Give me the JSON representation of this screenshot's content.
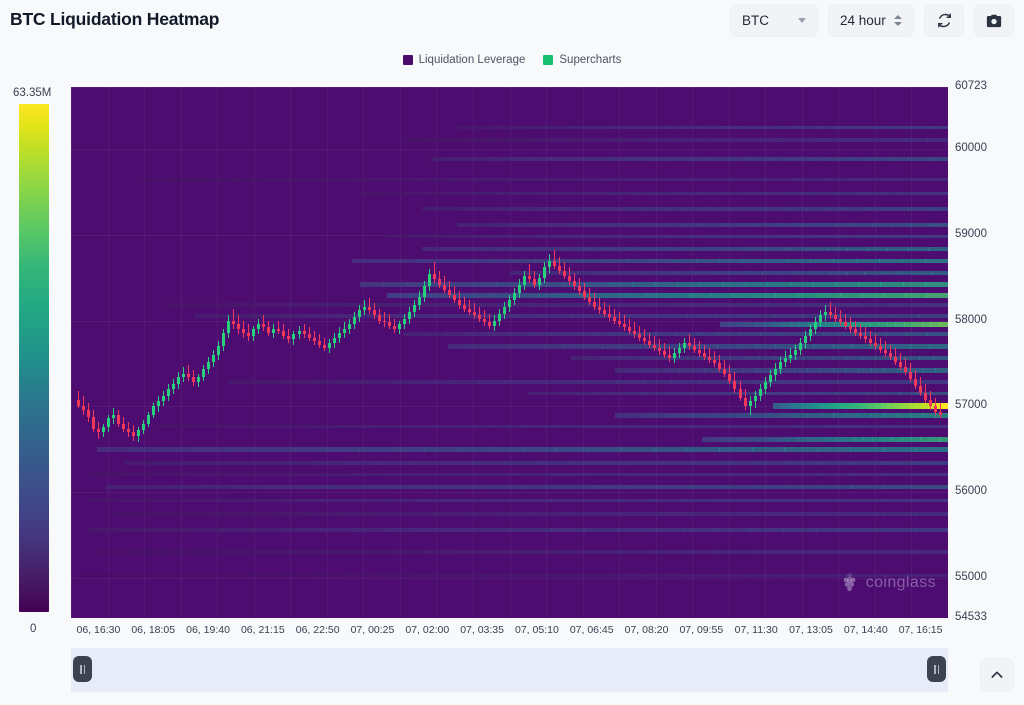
{
  "header": {
    "title": "BTC Liquidation Heatmap",
    "symbol_label": "BTC",
    "period_label": "24 hour",
    "refresh_icon": "refresh-icon",
    "camera_icon": "camera-icon"
  },
  "legend": [
    {
      "label": "Liquidation Leverage",
      "color": "#4b0a6e"
    },
    {
      "label": "Supercharts",
      "color": "#18bf6e"
    }
  ],
  "colorbar": {
    "max_label": "63.35M",
    "min_label": "0"
  },
  "watermark": {
    "text": "coinglass"
  },
  "chart_data": {
    "type": "heatmap",
    "title": "BTC Liquidation Heatmap",
    "xlabel": "",
    "ylabel": "",
    "grid": true,
    "legend_position": "top-center",
    "colorbar": {
      "label": "Liquidation Leverage",
      "min": 0,
      "max": 63350000,
      "max_label": "63.35M",
      "min_label": "0",
      "scale": "viridis"
    },
    "ylim": [
      54533,
      60723
    ],
    "y_ticks": [
      60723,
      60000,
      59000,
      58000,
      57000,
      56000,
      55000,
      54533
    ],
    "y_tick_labels": [
      "60723",
      "60000",
      "59000",
      "58000",
      "57000",
      "56000",
      "55000",
      "54533"
    ],
    "x_tick_labels": [
      "06, 16:30",
      "06, 18:05",
      "06, 19:40",
      "06, 21:15",
      "06, 22:50",
      "07, 00:25",
      "07, 02:00",
      "07, 03:35",
      "07, 05:10",
      "07, 06:45",
      "07, 08:20",
      "07, 09:55",
      "07, 11:30",
      "07, 13:05",
      "07, 14:40",
      "07, 16:15"
    ],
    "price_series_name": "BTC price (candlesticks)",
    "up_color": "#26d07c",
    "down_color": "#f2385a",
    "bands": [
      {
        "price": 60250,
        "start": 0.44,
        "intensity": 0.3
      },
      {
        "price": 60100,
        "start": 0.38,
        "intensity": 0.22
      },
      {
        "price": 59880,
        "start": 0.41,
        "intensity": 0.36
      },
      {
        "price": 59640,
        "start": 0.08,
        "intensity": 0.2
      },
      {
        "price": 59480,
        "start": 0.33,
        "intensity": 0.26
      },
      {
        "price": 59300,
        "start": 0.4,
        "intensity": 0.34
      },
      {
        "price": 59120,
        "start": 0.44,
        "intensity": 0.4
      },
      {
        "price": 58980,
        "start": 0.36,
        "intensity": 0.3
      },
      {
        "price": 58840,
        "start": 0.4,
        "intensity": 0.46
      },
      {
        "price": 58700,
        "start": 0.32,
        "intensity": 0.52
      },
      {
        "price": 58560,
        "start": 0.5,
        "intensity": 0.44
      },
      {
        "price": 58430,
        "start": 0.33,
        "intensity": 0.62
      },
      {
        "price": 58300,
        "start": 0.36,
        "intensity": 0.7
      },
      {
        "price": 58180,
        "start": 0.11,
        "intensity": 0.26
      },
      {
        "price": 58050,
        "start": 0.14,
        "intensity": 0.34
      },
      {
        "price": 57960,
        "start": 0.74,
        "intensity": 0.78
      },
      {
        "price": 57840,
        "start": 0.38,
        "intensity": 0.4
      },
      {
        "price": 57700,
        "start": 0.43,
        "intensity": 0.48
      },
      {
        "price": 57560,
        "start": 0.57,
        "intensity": 0.42
      },
      {
        "price": 57420,
        "start": 0.62,
        "intensity": 0.46
      },
      {
        "price": 57280,
        "start": 0.18,
        "intensity": 0.3
      },
      {
        "price": 57150,
        "start": 0.52,
        "intensity": 0.38
      },
      {
        "price": 57020,
        "start": 0.8,
        "intensity": 1.0
      },
      {
        "price": 56900,
        "start": 0.62,
        "intensity": 0.56
      },
      {
        "price": 56760,
        "start": 0.1,
        "intensity": 0.26
      },
      {
        "price": 56620,
        "start": 0.72,
        "intensity": 0.66
      },
      {
        "price": 56500,
        "start": 0.03,
        "intensity": 0.5
      },
      {
        "price": 56340,
        "start": 0.06,
        "intensity": 0.32
      },
      {
        "price": 56200,
        "start": 0.02,
        "intensity": 0.24
      },
      {
        "price": 56060,
        "start": 0.04,
        "intensity": 0.38
      },
      {
        "price": 55900,
        "start": 0.02,
        "intensity": 0.28
      },
      {
        "price": 55740,
        "start": 0.05,
        "intensity": 0.22
      },
      {
        "price": 55560,
        "start": 0.02,
        "intensity": 0.3
      },
      {
        "price": 55300,
        "start": 0.03,
        "intensity": 0.2
      },
      {
        "price": 55020,
        "start": 0.01,
        "intensity": 0.16
      }
    ],
    "candles": [
      [
        57080,
        57180,
        56980,
        57010
      ],
      [
        57010,
        57120,
        56900,
        56960
      ],
      [
        56960,
        57040,
        56820,
        56880
      ],
      [
        56880,
        56960,
        56700,
        56740
      ],
      [
        56740,
        56820,
        56620,
        56700
      ],
      [
        56700,
        56800,
        56640,
        56760
      ],
      [
        56760,
        56900,
        56700,
        56860
      ],
      [
        56860,
        56980,
        56800,
        56900
      ],
      [
        56900,
        56960,
        56760,
        56800
      ],
      [
        56800,
        56880,
        56700,
        56740
      ],
      [
        56740,
        56820,
        56640,
        56700
      ],
      [
        56700,
        56780,
        56600,
        56660
      ],
      [
        56660,
        56760,
        56580,
        56720
      ],
      [
        56720,
        56840,
        56680,
        56800
      ],
      [
        56800,
        56940,
        56760,
        56900
      ],
      [
        56900,
        57040,
        56860,
        57000
      ],
      [
        57000,
        57120,
        56940,
        57060
      ],
      [
        57060,
        57180,
        57000,
        57120
      ],
      [
        57120,
        57260,
        57060,
        57200
      ],
      [
        57200,
        57320,
        57140,
        57260
      ],
      [
        57260,
        57400,
        57200,
        57340
      ],
      [
        57340,
        57460,
        57280,
        57380
      ],
      [
        57380,
        57480,
        57300,
        57340
      ],
      [
        57340,
        57420,
        57240,
        57280
      ],
      [
        57280,
        57380,
        57220,
        57340
      ],
      [
        57340,
        57480,
        57300,
        57440
      ],
      [
        57440,
        57580,
        57380,
        57520
      ],
      [
        57520,
        57660,
        57460,
        57600
      ],
      [
        57600,
        57760,
        57540,
        57700
      ],
      [
        57700,
        57900,
        57640,
        57860
      ],
      [
        57860,
        58060,
        57800,
        58000
      ],
      [
        58000,
        58140,
        57900,
        57960
      ],
      [
        57960,
        58060,
        57840,
        57900
      ],
      [
        57900,
        58000,
        57800,
        57860
      ],
      [
        57860,
        57960,
        57760,
        57820
      ],
      [
        57820,
        57940,
        57760,
        57900
      ],
      [
        57900,
        58020,
        57840,
        57960
      ],
      [
        57960,
        58060,
        57880,
        57920
      ],
      [
        57920,
        58000,
        57820,
        57860
      ],
      [
        57860,
        57960,
        57800,
        57900
      ],
      [
        57900,
        58000,
        57840,
        57880
      ],
      [
        57880,
        57960,
        57780,
        57820
      ],
      [
        57820,
        57900,
        57740,
        57780
      ],
      [
        57780,
        57880,
        57720,
        57840
      ],
      [
        57840,
        57940,
        57780,
        57880
      ],
      [
        57880,
        57960,
        57800,
        57840
      ],
      [
        57840,
        57920,
        57760,
        57800
      ],
      [
        57800,
        57880,
        57720,
        57760
      ],
      [
        57760,
        57840,
        57680,
        57720
      ],
      [
        57720,
        57800,
        57640,
        57680
      ],
      [
        57680,
        57780,
        57620,
        57740
      ],
      [
        57740,
        57860,
        57680,
        57800
      ],
      [
        57800,
        57920,
        57740,
        57860
      ],
      [
        57860,
        57980,
        57800,
        57900
      ],
      [
        57900,
        58020,
        57840,
        57960
      ],
      [
        57960,
        58100,
        57900,
        58040
      ],
      [
        58040,
        58180,
        57980,
        58120
      ],
      [
        58120,
        58240,
        58060,
        58160
      ],
      [
        58160,
        58260,
        58080,
        58120
      ],
      [
        58120,
        58200,
        58020,
        58060
      ],
      [
        58060,
        58140,
        57960,
        58000
      ],
      [
        58000,
        58100,
        57920,
        57980
      ],
      [
        57980,
        58080,
        57900,
        57940
      ],
      [
        57940,
        58020,
        57860,
        57900
      ],
      [
        57900,
        58000,
        57840,
        57960
      ],
      [
        57960,
        58080,
        57900,
        58020
      ],
      [
        58020,
        58160,
        57960,
        58100
      ],
      [
        58100,
        58240,
        58040,
        58180
      ],
      [
        58180,
        58340,
        58120,
        58280
      ],
      [
        58280,
        58460,
        58220,
        58400
      ],
      [
        58400,
        58600,
        58340,
        58540
      ],
      [
        58540,
        58680,
        58440,
        58480
      ],
      [
        58480,
        58580,
        58380,
        58420
      ],
      [
        58420,
        58520,
        58320,
        58360
      ],
      [
        58360,
        58460,
        58260,
        58300
      ],
      [
        58300,
        58400,
        58200,
        58240
      ],
      [
        58240,
        58340,
        58140,
        58180
      ],
      [
        58180,
        58280,
        58100,
        58140
      ],
      [
        58140,
        58240,
        58060,
        58100
      ],
      [
        58100,
        58200,
        58020,
        58060
      ],
      [
        58060,
        58160,
        57980,
        58020
      ],
      [
        58020,
        58120,
        57940,
        57980
      ],
      [
        57980,
        58080,
        57900,
        57940
      ],
      [
        57940,
        58060,
        57880,
        58000
      ],
      [
        58000,
        58140,
        57940,
        58080
      ],
      [
        58080,
        58220,
        58020,
        58160
      ],
      [
        58160,
        58300,
        58100,
        58240
      ],
      [
        58240,
        58380,
        58180,
        58320
      ],
      [
        58320,
        58480,
        58260,
        58420
      ],
      [
        58420,
        58580,
        58360,
        58520
      ],
      [
        58520,
        58660,
        58440,
        58480
      ],
      [
        58480,
        58580,
        58380,
        58420
      ],
      [
        58420,
        58540,
        58360,
        58500
      ],
      [
        58500,
        58680,
        58440,
        58620
      ],
      [
        58620,
        58780,
        58560,
        58700
      ],
      [
        58700,
        58820,
        58600,
        58640
      ],
      [
        58640,
        58740,
        58540,
        58580
      ],
      [
        58580,
        58680,
        58480,
        58520
      ],
      [
        58520,
        58620,
        58420,
        58460
      ],
      [
        58460,
        58560,
        58360,
        58400
      ],
      [
        58400,
        58500,
        58300,
        58340
      ],
      [
        58340,
        58440,
        58240,
        58280
      ],
      [
        58280,
        58380,
        58180,
        58220
      ],
      [
        58220,
        58320,
        58120,
        58160
      ],
      [
        58160,
        58260,
        58080,
        58120
      ],
      [
        58120,
        58220,
        58040,
        58080
      ],
      [
        58080,
        58180,
        58000,
        58040
      ],
      [
        58040,
        58140,
        57960,
        58000
      ],
      [
        58000,
        58100,
        57920,
        57960
      ],
      [
        57960,
        58060,
        57880,
        57920
      ],
      [
        57920,
        58020,
        57840,
        57880
      ],
      [
        57880,
        57980,
        57800,
        57840
      ],
      [
        57840,
        57940,
        57760,
        57800
      ],
      [
        57800,
        57900,
        57720,
        57760
      ],
      [
        57760,
        57860,
        57680,
        57720
      ],
      [
        57720,
        57820,
        57640,
        57680
      ],
      [
        57680,
        57780,
        57600,
        57640
      ],
      [
        57640,
        57740,
        57560,
        57600
      ],
      [
        57600,
        57700,
        57520,
        57560
      ],
      [
        57560,
        57680,
        57500,
        57620
      ],
      [
        57620,
        57740,
        57560,
        57680
      ],
      [
        57680,
        57800,
        57620,
        57740
      ],
      [
        57740,
        57840,
        57660,
        57700
      ],
      [
        57700,
        57800,
        57620,
        57660
      ],
      [
        57660,
        57760,
        57580,
        57620
      ],
      [
        57620,
        57720,
        57540,
        57580
      ],
      [
        57580,
        57680,
        57500,
        57540
      ],
      [
        57540,
        57640,
        57460,
        57500
      ],
      [
        57500,
        57600,
        57400,
        57440
      ],
      [
        57440,
        57540,
        57340,
        57380
      ],
      [
        57380,
        57480,
        57260,
        57300
      ],
      [
        57300,
        57400,
        57160,
        57200
      ],
      [
        57200,
        57300,
        57060,
        57100
      ],
      [
        57100,
        57200,
        56960,
        57000
      ],
      [
        57000,
        57120,
        56900,
        57060
      ],
      [
        57060,
        57180,
        56980,
        57120
      ],
      [
        57120,
        57260,
        57060,
        57200
      ],
      [
        57200,
        57340,
        57140,
        57280
      ],
      [
        57280,
        57420,
        57220,
        57360
      ],
      [
        57360,
        57500,
        57300,
        57440
      ],
      [
        57440,
        57580,
        57380,
        57520
      ],
      [
        57520,
        57640,
        57460,
        57560
      ],
      [
        57560,
        57680,
        57500,
        57600
      ],
      [
        57600,
        57720,
        57540,
        57660
      ],
      [
        57660,
        57800,
        57600,
        57740
      ],
      [
        57740,
        57880,
        57680,
        57820
      ],
      [
        57820,
        57960,
        57760,
        57900
      ],
      [
        57900,
        58040,
        57840,
        57980
      ],
      [
        57980,
        58120,
        57920,
        58060
      ],
      [
        58060,
        58180,
        58000,
        58100
      ],
      [
        58100,
        58220,
        58020,
        58060
      ],
      [
        58060,
        58160,
        57980,
        58020
      ],
      [
        58020,
        58120,
        57940,
        57980
      ],
      [
        57980,
        58080,
        57900,
        57940
      ],
      [
        57940,
        58040,
        57860,
        57900
      ],
      [
        57900,
        58000,
        57820,
        57860
      ],
      [
        57860,
        57960,
        57780,
        57820
      ],
      [
        57820,
        57920,
        57740,
        57780
      ],
      [
        57780,
        57880,
        57700,
        57740
      ],
      [
        57740,
        57840,
        57660,
        57700
      ],
      [
        57700,
        57800,
        57620,
        57660
      ],
      [
        57660,
        57760,
        57580,
        57620
      ],
      [
        57620,
        57720,
        57540,
        57580
      ],
      [
        57580,
        57680,
        57480,
        57520
      ],
      [
        57520,
        57620,
        57420,
        57460
      ],
      [
        57460,
        57560,
        57360,
        57400
      ],
      [
        57400,
        57500,
        57280,
        57320
      ],
      [
        57320,
        57420,
        57200,
        57240
      ],
      [
        57240,
        57340,
        57120,
        57160
      ],
      [
        57160,
        57260,
        57040,
        57080
      ],
      [
        57080,
        57180,
        56960,
        57000
      ],
      [
        57000,
        57100,
        56900,
        56940
      ],
      [
        56940,
        57040,
        56860,
        56900
      ]
    ]
  },
  "range_slider": {
    "left_handle": "range-left-handle",
    "right_handle": "range-right-handle"
  },
  "scroll_top": {
    "icon": "chevron-up-icon"
  }
}
